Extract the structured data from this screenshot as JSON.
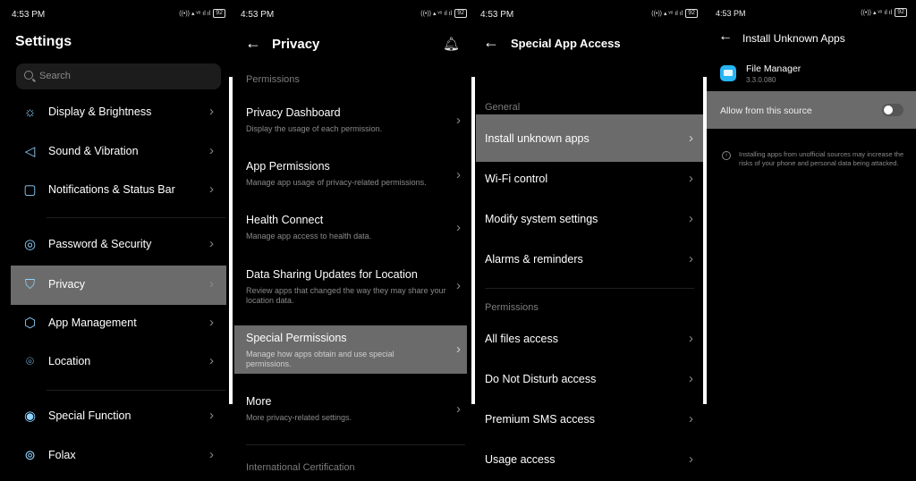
{
  "panel1": {
    "time": "4:53 PM",
    "battery": "92",
    "title": "Settings",
    "search_placeholder": "Search",
    "items": [
      {
        "label": "Display & Brightness",
        "icon": "sun-icon"
      },
      {
        "label": "Sound & Vibration",
        "icon": "speaker-icon"
      },
      {
        "label": "Notifications & Status Bar",
        "icon": "notification-icon"
      },
      {
        "label": "Password & Security",
        "icon": "fingerprint-icon"
      },
      {
        "label": "Privacy",
        "icon": "shield-icon"
      },
      {
        "label": "App Management",
        "icon": "cube-icon"
      },
      {
        "label": "Location",
        "icon": "location-pin-icon"
      },
      {
        "label": "Special Function",
        "icon": "special-function-icon"
      },
      {
        "label": "Folax",
        "icon": "folax-icon"
      }
    ]
  },
  "panel2": {
    "time": "4:53 PM",
    "battery": "92",
    "title": "Privacy",
    "section": "Permissions",
    "items": [
      {
        "title": "Privacy Dashboard",
        "subtitle": "Display the usage of each permission."
      },
      {
        "title": "App Permissions",
        "subtitle": "Manage app usage of privacy-related permissions."
      },
      {
        "title": "Health Connect",
        "subtitle": "Manage app access to health data."
      },
      {
        "title": "Data Sharing Updates for Location",
        "subtitle": "Review apps that changed the way they may share your location data."
      },
      {
        "title": "Special Permissions",
        "subtitle": "Manage how apps obtain and use special permissions."
      },
      {
        "title": "More",
        "subtitle": "More privacy-related settings."
      }
    ],
    "footer_section": "International Certification"
  },
  "panel3": {
    "time": "4:53 PM",
    "battery": "92",
    "title": "Special App Access",
    "section_general": "General",
    "general_items": [
      "Install unknown apps",
      "Wi-Fi control",
      "Modify system settings",
      "Alarms & reminders"
    ],
    "section_permissions": "Permissions",
    "permission_items": [
      "All files access",
      "Do Not Disturb access",
      "Premium SMS access",
      "Usage access"
    ]
  },
  "panel4": {
    "time": "4:53 PM",
    "battery": "92",
    "title": "Install Unknown Apps",
    "app_name": "File Manager",
    "app_version": "3.3.0.080",
    "toggle_label": "Allow from this source",
    "toggle_on": false,
    "info_text": "Installing apps from unofficial sources may increase the risks of your phone and personal data being attacked."
  },
  "colors": {
    "highlight": "#6b6b6b",
    "icon_accent": "#8fd3ff",
    "app_icon": "#26b5f5"
  }
}
